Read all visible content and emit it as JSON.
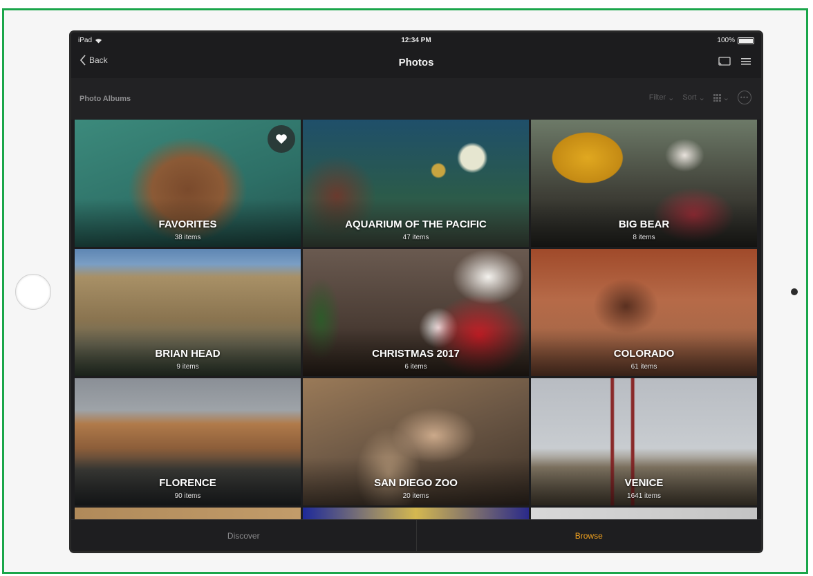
{
  "status": {
    "device": "iPad",
    "time": "12:34 PM",
    "battery": "100%"
  },
  "nav": {
    "back_label": "Back",
    "title": "Photos"
  },
  "subbar": {
    "title": "Photo Albums",
    "filter_label": "Filter",
    "sort_label": "Sort"
  },
  "albums": [
    {
      "name": "FAVORITES",
      "count": "38 items"
    },
    {
      "name": "AQUARIUM OF THE PACIFIC",
      "count": "47 items"
    },
    {
      "name": "BIG BEAR",
      "count": "8 items"
    },
    {
      "name": "BRIAN HEAD",
      "count": "9 items"
    },
    {
      "name": "CHRISTMAS 2017",
      "count": "6 items"
    },
    {
      "name": "COLORADO",
      "count": "61 items"
    },
    {
      "name": "FLORENCE",
      "count": "90 items"
    },
    {
      "name": "SAN DIEGO ZOO",
      "count": "20 items"
    },
    {
      "name": "VENICE",
      "count": "1641 items"
    }
  ],
  "tabs": {
    "discover": "Discover",
    "browse": "Browse"
  },
  "colors": {
    "frame_border": "#1aa64a",
    "active_tab": "#f0a11f"
  }
}
